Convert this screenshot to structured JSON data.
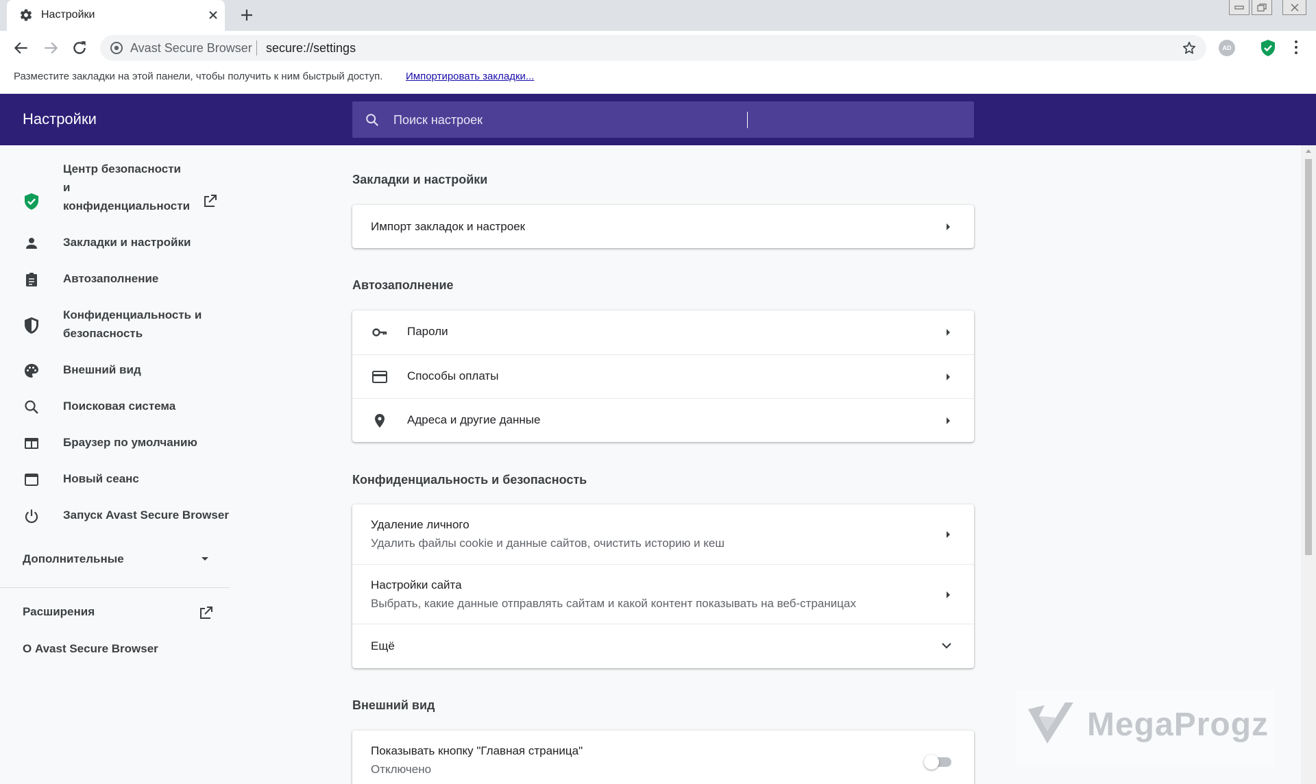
{
  "browser": {
    "tab": {
      "title": "Настройки",
      "icon": "gear-icon"
    },
    "omnibox": {
      "site_name": "Avast Secure Browser",
      "url": "secure://settings"
    },
    "profile_initials": "AD"
  },
  "bookmarks_bar": {
    "hint": "Разместите закладки на этой панели, чтобы получить к ним быстрый доступ.",
    "import_link": "Импортировать закладки..."
  },
  "header": {
    "title": "Настройки",
    "search_placeholder": "Поиск настроек"
  },
  "sidebar": {
    "items": [
      {
        "label": "Центр безопасности\nи\nконфиденциальности",
        "icon": "shield-check-icon",
        "external": true
      },
      {
        "label": "Закладки и настройки",
        "icon": "person-icon"
      },
      {
        "label": "Автозаполнение",
        "icon": "clipboard-icon"
      },
      {
        "label": "Конфиденциальность и\nбезопасность",
        "icon": "shield-icon"
      },
      {
        "label": "Внешний вид",
        "icon": "palette-icon"
      },
      {
        "label": "Поисковая система",
        "icon": "search-icon"
      },
      {
        "label": "Браузер по умолчанию",
        "icon": "browser-window-icon"
      },
      {
        "label": "Новый сеанс",
        "icon": "new-window-icon"
      },
      {
        "label": "Запуск Avast Secure Browser",
        "icon": "power-icon"
      }
    ],
    "more_label": "Дополнительные",
    "extensions_label": "Расширения",
    "about_label": "О Avast Secure Browser"
  },
  "main": {
    "sections": [
      {
        "title": "Закладки и настройки",
        "rows": [
          {
            "label": "Импорт закладок и настроек"
          }
        ]
      },
      {
        "title": "Автозаполнение",
        "rows": [
          {
            "label": "Пароли",
            "icon": "key-icon"
          },
          {
            "label": "Способы оплаты",
            "icon": "credit-card-icon"
          },
          {
            "label": "Адреса и другие данные",
            "icon": "location-pin-icon"
          }
        ]
      },
      {
        "title": "Конфиденциальность и безопасность",
        "rows": [
          {
            "label": "Удаление личного",
            "sub": "Удалить файлы cookie и данные сайтов, очистить историю и кеш"
          },
          {
            "label": "Настройки сайта",
            "sub": "Выбрать, какие данные отправлять сайтам и какой контент показывать на веб-страницах"
          },
          {
            "label": "Ещё"
          }
        ]
      },
      {
        "title": "Внешний вид",
        "rows": [
          {
            "label": "Показывать кнопку \"Главная страница\"",
            "sub": "Отключено",
            "toggle_on": false
          }
        ]
      }
    ]
  },
  "watermark": {
    "text": "MegaProgz"
  },
  "colors": {
    "header_bg": "#2d1e76",
    "search_bg": "#4d3f96",
    "shield_green": "#0f9d58",
    "page_bg": "#f8f9fa"
  }
}
